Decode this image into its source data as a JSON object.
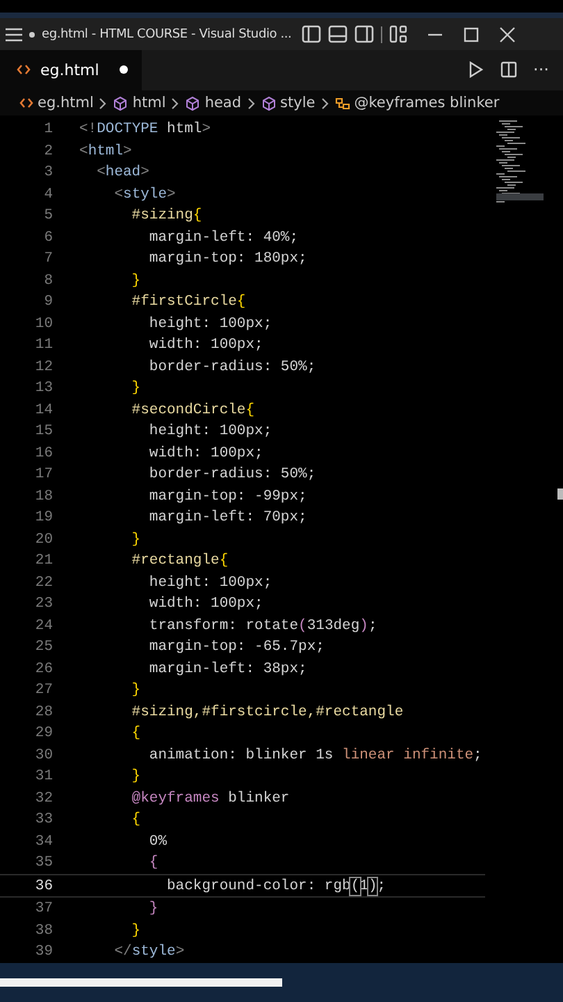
{
  "window": {
    "title": "eg.html - HTML COURSE - Visual Studio ...",
    "modified": true
  },
  "tabs": [
    {
      "label": "eg.html",
      "selected": true,
      "modified": true
    }
  ],
  "editor_actions": {
    "more": "···"
  },
  "breadcrumb": [
    {
      "label": "eg.html",
      "kind": "file"
    },
    {
      "label": "html",
      "kind": "element"
    },
    {
      "label": "head",
      "kind": "element"
    },
    {
      "label": "style",
      "kind": "element"
    },
    {
      "label": "@keyframes blinker",
      "kind": "rule"
    }
  ],
  "code": [
    {
      "number": "1",
      "current": false,
      "tokens": [
        {
          "kind": "punct",
          "text": "<!"
        },
        {
          "kind": "tag",
          "text": "DOCTYPE"
        },
        {
          "kind": "prop",
          "text": " html"
        },
        {
          "kind": "punct",
          "text": ">"
        }
      ]
    },
    {
      "number": "2",
      "current": false,
      "tokens": [
        {
          "kind": "punct",
          "text": "<"
        },
        {
          "kind": "tag",
          "text": "html"
        },
        {
          "kind": "punct",
          "text": ">"
        }
      ]
    },
    {
      "number": "3",
      "current": false,
      "tokens": [
        {
          "kind": "punct",
          "text": "  <"
        },
        {
          "kind": "tag",
          "text": "head"
        },
        {
          "kind": "punct",
          "text": ">"
        }
      ]
    },
    {
      "number": "4",
      "current": false,
      "tokens": [
        {
          "kind": "punct",
          "text": "    <"
        },
        {
          "kind": "tag",
          "text": "style"
        },
        {
          "kind": "punct",
          "text": ">"
        }
      ]
    },
    {
      "number": "5",
      "current": false,
      "tokens": [
        {
          "kind": "selector",
          "text": "      #sizing"
        },
        {
          "kind": "brace",
          "text": "{"
        }
      ]
    },
    {
      "number": "6",
      "current": false,
      "tokens": [
        {
          "kind": "prop",
          "text": "        margin-left: 40%;"
        }
      ]
    },
    {
      "number": "7",
      "current": false,
      "tokens": [
        {
          "kind": "prop",
          "text": "        margin-top: 180px;"
        }
      ]
    },
    {
      "number": "8",
      "current": false,
      "tokens": [
        {
          "kind": "brace",
          "text": "      }"
        }
      ]
    },
    {
      "number": "9",
      "current": false,
      "tokens": [
        {
          "kind": "selector",
          "text": "      #firstCircle"
        },
        {
          "kind": "brace",
          "text": "{"
        }
      ]
    },
    {
      "number": "10",
      "current": false,
      "tokens": [
        {
          "kind": "prop",
          "text": "        height: 100px;"
        }
      ]
    },
    {
      "number": "11",
      "current": false,
      "tokens": [
        {
          "kind": "prop",
          "text": "        width: 100px;"
        }
      ]
    },
    {
      "number": "12",
      "current": false,
      "tokens": [
        {
          "kind": "prop",
          "text": "        border-radius: 50%;"
        }
      ]
    },
    {
      "number": "13",
      "current": false,
      "tokens": [
        {
          "kind": "brace",
          "text": "      }"
        }
      ]
    },
    {
      "number": "14",
      "current": false,
      "tokens": [
        {
          "kind": "selector",
          "text": "      #secondCircle"
        },
        {
          "kind": "brace",
          "text": "{"
        }
      ]
    },
    {
      "number": "15",
      "current": false,
      "tokens": [
        {
          "kind": "prop",
          "text": "        height: 100px;"
        }
      ]
    },
    {
      "number": "16",
      "current": false,
      "tokens": [
        {
          "kind": "prop",
          "text": "        width: 100px;"
        }
      ]
    },
    {
      "number": "17",
      "current": false,
      "tokens": [
        {
          "kind": "prop",
          "text": "        border-radius: 50%;"
        }
      ]
    },
    {
      "number": "18",
      "current": false,
      "tokens": [
        {
          "kind": "prop",
          "text": "        margin-top: -99px;"
        }
      ]
    },
    {
      "number": "19",
      "current": false,
      "tokens": [
        {
          "kind": "prop",
          "text": "        margin-left: 70px;"
        }
      ]
    },
    {
      "number": "20",
      "current": false,
      "tokens": [
        {
          "kind": "brace",
          "text": "      }"
        }
      ]
    },
    {
      "number": "21",
      "current": false,
      "tokens": [
        {
          "kind": "selector",
          "text": "      #rectangle"
        },
        {
          "kind": "brace",
          "text": "{"
        }
      ]
    },
    {
      "number": "22",
      "current": false,
      "tokens": [
        {
          "kind": "prop",
          "text": "        height: 100px;"
        }
      ]
    },
    {
      "number": "23",
      "current": false,
      "tokens": [
        {
          "kind": "prop",
          "text": "        width: 100px;"
        }
      ]
    },
    {
      "number": "24",
      "current": false,
      "tokens": [
        {
          "kind": "prop",
          "text": "        transform: rotate"
        },
        {
          "kind": "paren",
          "text": "("
        },
        {
          "kind": "prop",
          "text": "313deg"
        },
        {
          "kind": "paren",
          "text": ")"
        },
        {
          "kind": "prop",
          "text": ";"
        }
      ]
    },
    {
      "number": "25",
      "current": false,
      "tokens": [
        {
          "kind": "prop",
          "text": "        margin-top: -65.7px;"
        }
      ]
    },
    {
      "number": "26",
      "current": false,
      "tokens": [
        {
          "kind": "prop",
          "text": "        margin-left: 38px;"
        }
      ]
    },
    {
      "number": "27",
      "current": false,
      "tokens": [
        {
          "kind": "brace",
          "text": "      }"
        }
      ]
    },
    {
      "number": "28",
      "current": false,
      "tokens": [
        {
          "kind": "selector",
          "text": "      #sizing,#firstcircle,#rectangle"
        }
      ]
    },
    {
      "number": "29",
      "current": false,
      "tokens": [
        {
          "kind": "brace",
          "text": "      {"
        }
      ]
    },
    {
      "number": "30",
      "current": false,
      "tokens": [
        {
          "kind": "prop",
          "text": "        animation: blinker 1s "
        },
        {
          "kind": "value",
          "text": "linear infinite"
        },
        {
          "kind": "prop",
          "text": ";"
        }
      ]
    },
    {
      "number": "31",
      "current": false,
      "tokens": [
        {
          "kind": "brace",
          "text": "      }"
        }
      ]
    },
    {
      "number": "32",
      "current": false,
      "tokens": [
        {
          "kind": "atrule",
          "text": "      @keyframes"
        },
        {
          "kind": "prop",
          "text": " blinker"
        }
      ]
    },
    {
      "number": "33",
      "current": false,
      "tokens": [
        {
          "kind": "brace",
          "text": "      {"
        }
      ]
    },
    {
      "number": "34",
      "current": false,
      "tokens": [
        {
          "kind": "prop",
          "text": "        0%"
        }
      ]
    },
    {
      "number": "35",
      "current": false,
      "tokens": [
        {
          "kind": "paren",
          "text": "        {"
        }
      ]
    },
    {
      "number": "36",
      "current": true,
      "tokens": [
        {
          "kind": "prop",
          "text": "          background-color: rgb"
        },
        {
          "kind": "match",
          "text": "("
        },
        {
          "kind": "prop",
          "text": "1"
        },
        {
          "kind": "match",
          "text": ")"
        },
        {
          "kind": "prop",
          "text": ";"
        }
      ]
    },
    {
      "number": "37",
      "current": false,
      "tokens": [
        {
          "kind": "paren",
          "text": "        }"
        }
      ]
    },
    {
      "number": "38",
      "current": false,
      "tokens": [
        {
          "kind": "brace",
          "text": "      }"
        }
      ]
    },
    {
      "number": "39",
      "current": false,
      "tokens": [
        {
          "kind": "punct",
          "text": "    </"
        },
        {
          "kind": "tag",
          "text": "style"
        },
        {
          "kind": "punct",
          "text": ">"
        }
      ]
    }
  ],
  "video_progress": {
    "level": 0.5
  }
}
